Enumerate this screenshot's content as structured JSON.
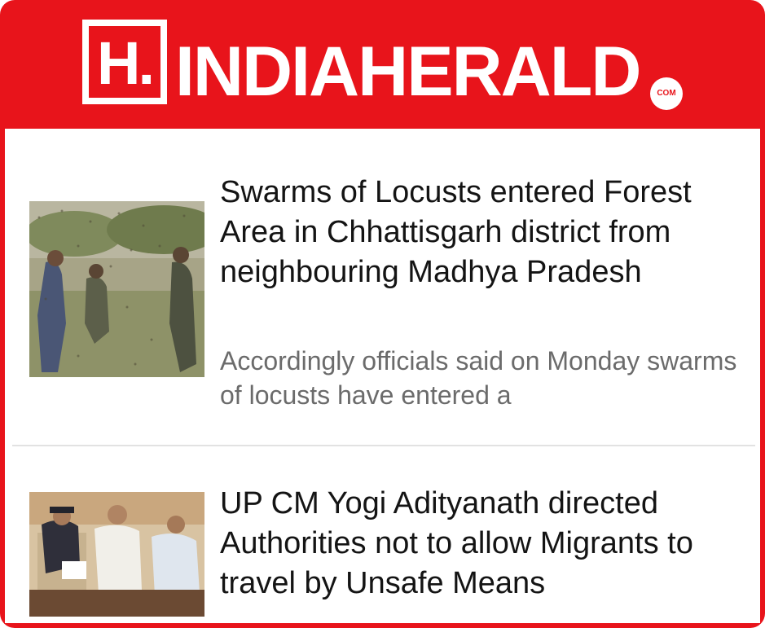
{
  "header": {
    "logo_mark": "H.",
    "logo_name": "INDIAHERALD",
    "logo_suffix": "COM",
    "brand_color": "#e8141b"
  },
  "articles": [
    {
      "title": "Swarms of Locusts entered Forest Area in Chhattisgarh district from neighbouring Madhya Pradesh",
      "summary": "Accordingly officials said on Monday swarms of locusts have entered a",
      "image_icon": "locust-swarm-photo"
    },
    {
      "title": "UP CM Yogi Adityanath directed Authorities not to allow Migrants to travel by Unsafe Means",
      "summary": "",
      "image_icon": "officials-meeting-photo"
    }
  ]
}
